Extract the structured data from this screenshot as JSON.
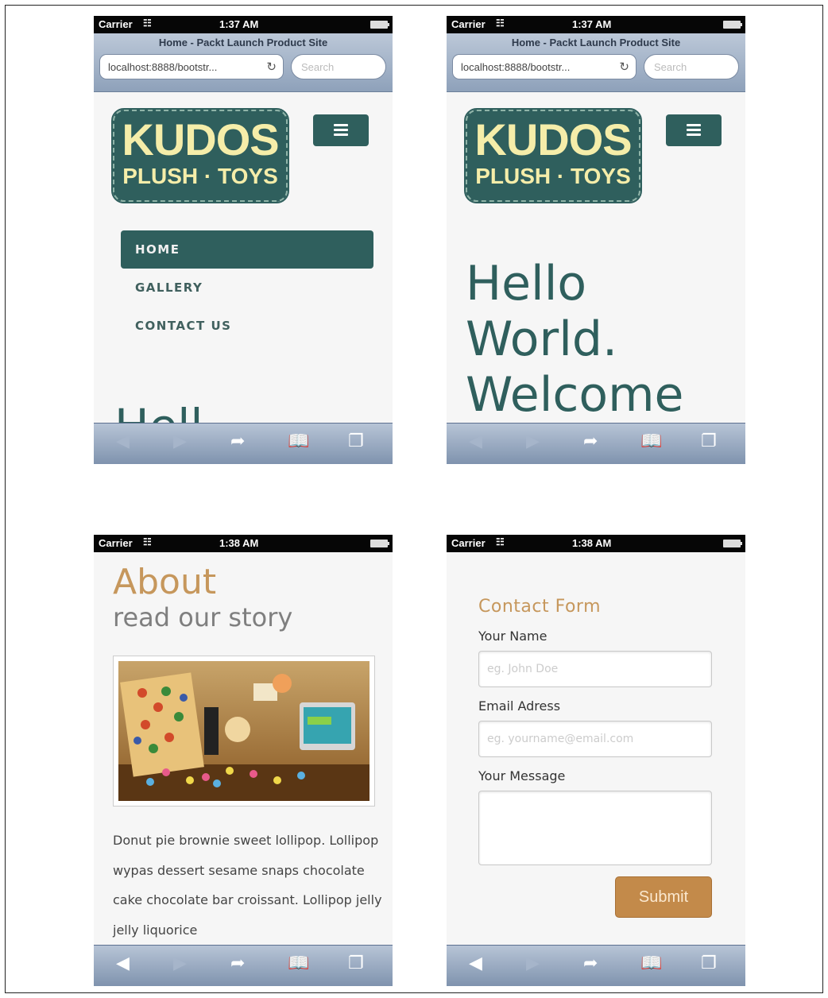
{
  "status_top": {
    "carrier": "Carrier",
    "time": "1:37 AM"
  },
  "status_bottom": {
    "carrier": "Carrier",
    "time": "1:38 AM"
  },
  "safari": {
    "page_title": "Home - Packt Launch Product Site",
    "url": "localhost:8888/bootstr...",
    "search_placeholder": "Search"
  },
  "logo": {
    "line1": "KUDOS",
    "line2": "PLUSH · TOYS"
  },
  "nav": {
    "items": [
      "HOME",
      "GALLERY",
      "CONTACT US"
    ],
    "active": "HOME"
  },
  "hero": {
    "peek": "Hell",
    "line1": "Hello",
    "line2": "World.",
    "line3": "Welcome"
  },
  "about": {
    "title": "About",
    "subtitle": "read our story",
    "body": "Donut pie brownie sweet lollipop. Lollipop wypas dessert sesame snaps chocolate cake chocolate bar croissant. Lollipop jelly jelly liquorice"
  },
  "contact": {
    "title": "Contact Form",
    "name_label": "Your Name",
    "name_placeholder": "eg. John Doe",
    "email_label": "Email Adress",
    "email_placeholder": "eg. yourname@email.com",
    "message_label": "Your Message",
    "submit_label": "Submit"
  },
  "icons": {
    "back": "back-arrow-icon",
    "forward": "forward-arrow-icon",
    "share": "share-icon",
    "bookmarks": "bookmarks-icon",
    "tabs": "tabs-icon",
    "menu": "hamburger-menu-icon",
    "wifi": "wifi-icon",
    "battery": "battery-icon",
    "reload": "reload-icon"
  },
  "colors": {
    "brand": "#2f5f5d",
    "accent": "#c6975c",
    "logo_text": "#f5eda9"
  }
}
